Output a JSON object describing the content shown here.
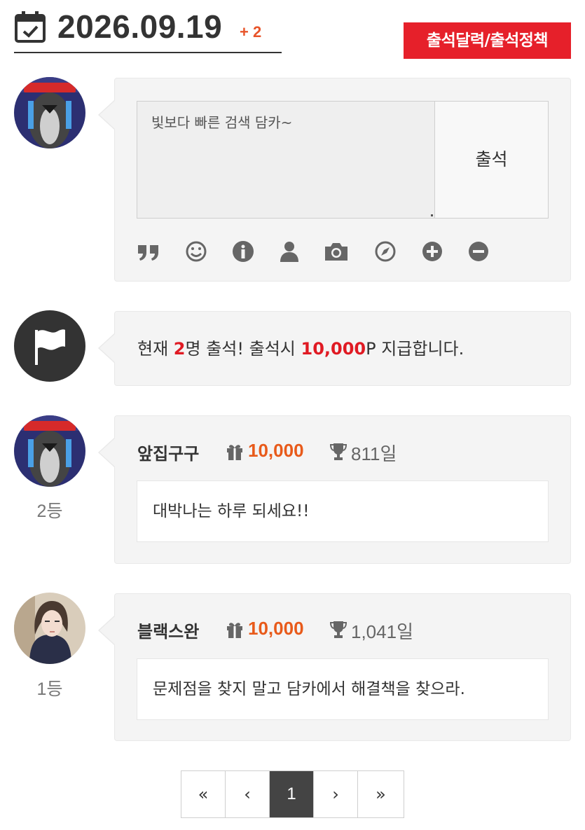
{
  "header": {
    "date": "2026.09.19",
    "plus": "+ 2",
    "policy_button": "출석달력/출석정책"
  },
  "compose": {
    "memo_value": "빛보다 빠른 검색 담카~",
    "attend_button": "출석",
    "toolbar": [
      "quote-icon",
      "smile-icon",
      "info-icon",
      "user-icon",
      "camera-icon",
      "compass-icon",
      "plus-circle-icon",
      "minus-circle-icon"
    ]
  },
  "notice": {
    "prefix": "현재 ",
    "count": "2",
    "middle": "명 출석! 출석시 ",
    "points": "10,000",
    "suffix": "P 지급합니다."
  },
  "entries": [
    {
      "nickname": "앞집구구",
      "points": "10,000",
      "days": "811일",
      "comment": "대박나는 하루 되세요!!",
      "rank": "2등"
    },
    {
      "nickname": "블랙스완",
      "points": "10,000",
      "days": "1,041일",
      "comment": "문제점을 찾지 말고 담카에서 해결책을 찾으라.",
      "rank": "1등"
    }
  ],
  "pagination": {
    "first": "«",
    "prev": "‹",
    "current": "1",
    "next": "›",
    "last": "»"
  },
  "colors": {
    "accent_red": "#e6202a",
    "points_orange": "#e85a1a",
    "dark": "#333333"
  }
}
